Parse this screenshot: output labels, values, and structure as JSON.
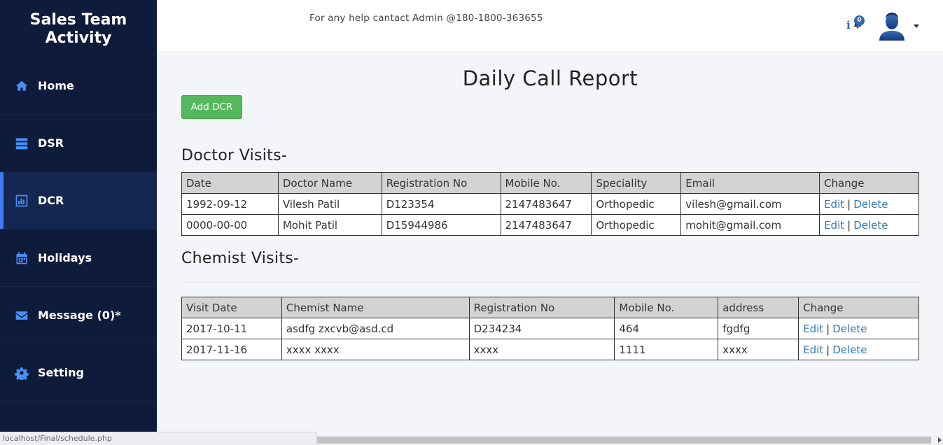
{
  "sidebar": {
    "brand": "Sales Team Activity",
    "items": [
      {
        "label": "Home",
        "icon": "home-icon"
      },
      {
        "label": "DSR",
        "icon": "server-icon"
      },
      {
        "label": "DCR",
        "icon": "bar-chart-icon",
        "active": true
      },
      {
        "label": "Holidays",
        "icon": "calendar-icon"
      },
      {
        "label": "Message (0)*",
        "icon": "envelope-icon"
      },
      {
        "label": "Setting",
        "icon": "gear-icon"
      }
    ]
  },
  "topbar": {
    "help_text": "For any help cantact Admin @180-1800-363655",
    "notification_count": "0"
  },
  "main": {
    "title": "Daily Call Report",
    "add_button": "Add DCR",
    "doctor_section": {
      "title": "Doctor Visits-",
      "columns": [
        "Date",
        "Doctor Name",
        "Registration No",
        "Mobile No.",
        "Speciality",
        "Email",
        "Change"
      ],
      "rows": [
        [
          "1992-09-12",
          "Vilesh Patil",
          "D123354",
          "2147483647",
          "Orthopedic",
          "vilesh@gmail.com"
        ],
        [
          "0000-00-00",
          "Mohit Patil",
          "D15944986",
          "2147483647",
          "Orthopedic",
          "mohit@gmail.com"
        ]
      ]
    },
    "chemist_section": {
      "title": "Chemist Visits-",
      "columns": [
        "Visit Date",
        "Chemist Name",
        "Registration No",
        "Mobile No.",
        "address",
        "Change"
      ],
      "rows": [
        [
          "2017-10-11",
          "asdfg zxcvb@asd.cd",
          "D234234",
          "464",
          "fgdfg"
        ],
        [
          "2017-11-16",
          "xxxx xxxx",
          "xxxx",
          "1111",
          "xxxx"
        ]
      ]
    },
    "edit_label": "Edit",
    "delete_label": "Delete",
    "separator": "|"
  },
  "statusbar": {
    "url": "localhost/Final/schedule.php"
  },
  "colors": {
    "sidebar_bg": "#0f1b3b",
    "accent": "#3d7bf2",
    "add_button": "#55b85c",
    "link": "#337ab7"
  }
}
